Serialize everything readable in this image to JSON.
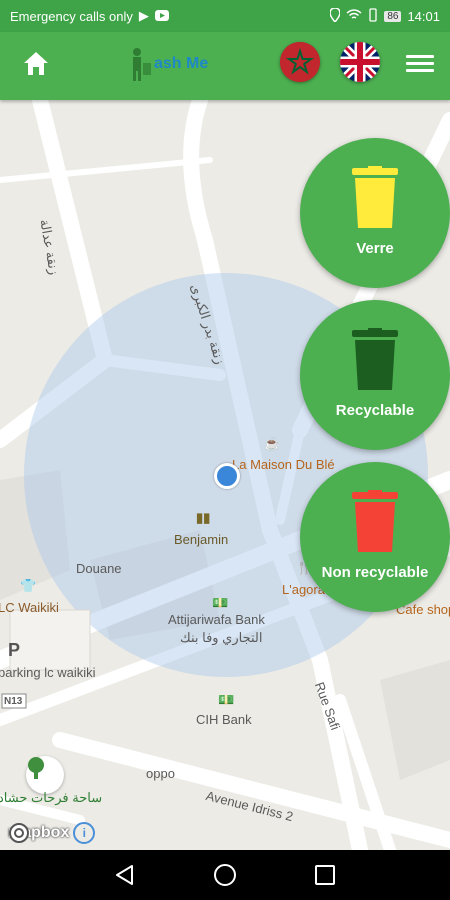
{
  "status_bar": {
    "carrier_text": "Emergency calls only",
    "battery": "86",
    "time": "14:01"
  },
  "app_bar": {
    "app_name_text": "ash Me",
    "home_icon": "home-icon",
    "menu_icon": "hamburger-menu-icon",
    "flags": [
      "morocco-flag",
      "uk-flag"
    ]
  },
  "map": {
    "labels": {
      "street_adala": "زنقة عدالة",
      "street_badr": "زنقة بدر الكبرى",
      "maison": "La Maison Du Blé",
      "benjamin": "Benjamin",
      "douane": "Douane",
      "waikiki": "LC Waikiki",
      "parking": "parking lc waikiki",
      "attijari": "Attijariwafa Bank",
      "attijari_ar": "التجاري وفا بنك",
      "agora": "L'agora",
      "cafe_shop": "Cafe shop",
      "cih": "CIH Bank",
      "oppo": "oppo",
      "rue_safi": "Rue Safi",
      "avenue_idriss": "Avenue Idriss 2",
      "square_ar": "ساحة فرحات حشاد",
      "road_n13": "N13",
      "parking_p": "P"
    },
    "attribution": "mapbox",
    "info": "i"
  },
  "categories": [
    {
      "label": "Verre",
      "color": "#ffeb3b"
    },
    {
      "label": "Recyclable",
      "color": "#1b5e20"
    },
    {
      "label": "Non recyclable",
      "color": "#f44336"
    }
  ],
  "colors": {
    "primary": "#4caf50",
    "status_bar": "#3ea447",
    "user_location": "#3a86d8"
  }
}
